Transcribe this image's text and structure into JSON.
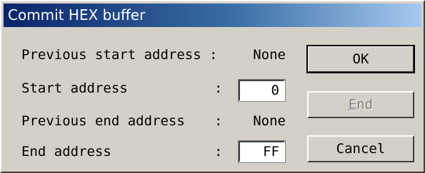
{
  "window": {
    "title": "Commit HEX buffer"
  },
  "rows": [
    {
      "label": "Previous start address",
      "colon": ":",
      "value": "None"
    },
    {
      "label": "Start address",
      "colon": ":",
      "input_value": "0"
    },
    {
      "label": "Previous end address",
      "colon": ":",
      "value": "None"
    },
    {
      "label": "End address",
      "colon": ":",
      "input_value": "FF"
    }
  ],
  "buttons": {
    "ok": "OK",
    "end_mnemonic": "E",
    "end_rest": "nd",
    "cancel": "Cancel"
  }
}
